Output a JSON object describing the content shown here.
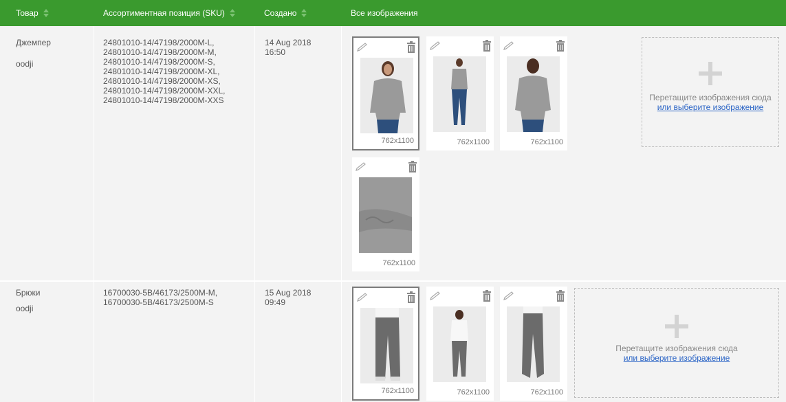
{
  "table": {
    "headers": {
      "product": "Товар",
      "sku": "Ассортиментная позиция (SKU)",
      "created": "Создано",
      "images": "Все изображения"
    },
    "rows": [
      {
        "name": "Джемпер",
        "brand": "oodji",
        "skus": [
          "24801010-14/47198/2000M-L,",
          "24801010-14/47198/2000M-M,",
          "24801010-14/47198/2000M-S,",
          "24801010-14/47198/2000M-XL,",
          "24801010-14/47198/2000M-XS,",
          "24801010-14/47198/2000M-XXL,",
          "24801010-14/47198/2000M-XXS"
        ],
        "created_date": "14 Aug 2018",
        "created_time": "16:50",
        "images": [
          {
            "size": "762x1100",
            "selected": true,
            "subject": "grey-jumper-front"
          },
          {
            "size": "762x1100",
            "selected": false,
            "subject": "grey-jumper-full-body"
          },
          {
            "size": "762x1100",
            "selected": false,
            "subject": "grey-jumper-back"
          },
          {
            "size": "762x1100",
            "selected": false,
            "subject": "grey-knit-fabric-detail"
          }
        ]
      },
      {
        "name": "Брюки",
        "brand": "oodji",
        "skus": [
          "16700030-5B/46173/2500M-M,",
          "16700030-5B/46173/2500M-S"
        ],
        "created_date": "15 Aug 2018",
        "created_time": "09:49",
        "images": [
          {
            "size": "762x1100",
            "selected": true,
            "subject": "grey-joggers-front"
          },
          {
            "size": "762x1100",
            "selected": false,
            "subject": "grey-joggers-full-body"
          },
          {
            "size": "762x1100",
            "selected": false,
            "subject": "grey-joggers-side"
          }
        ]
      }
    ]
  },
  "dropzone": {
    "text": "Перетащите изображения сюда",
    "link": "или выберите изображение"
  },
  "icons": {
    "edit": "pencil-icon",
    "delete": "trash-icon",
    "sort": "sort-icon",
    "add": "plus-icon"
  },
  "colors": {
    "header_bg": "#3a9a2e",
    "link": "#2a64c6",
    "row_bg": "#f3f3f3"
  }
}
